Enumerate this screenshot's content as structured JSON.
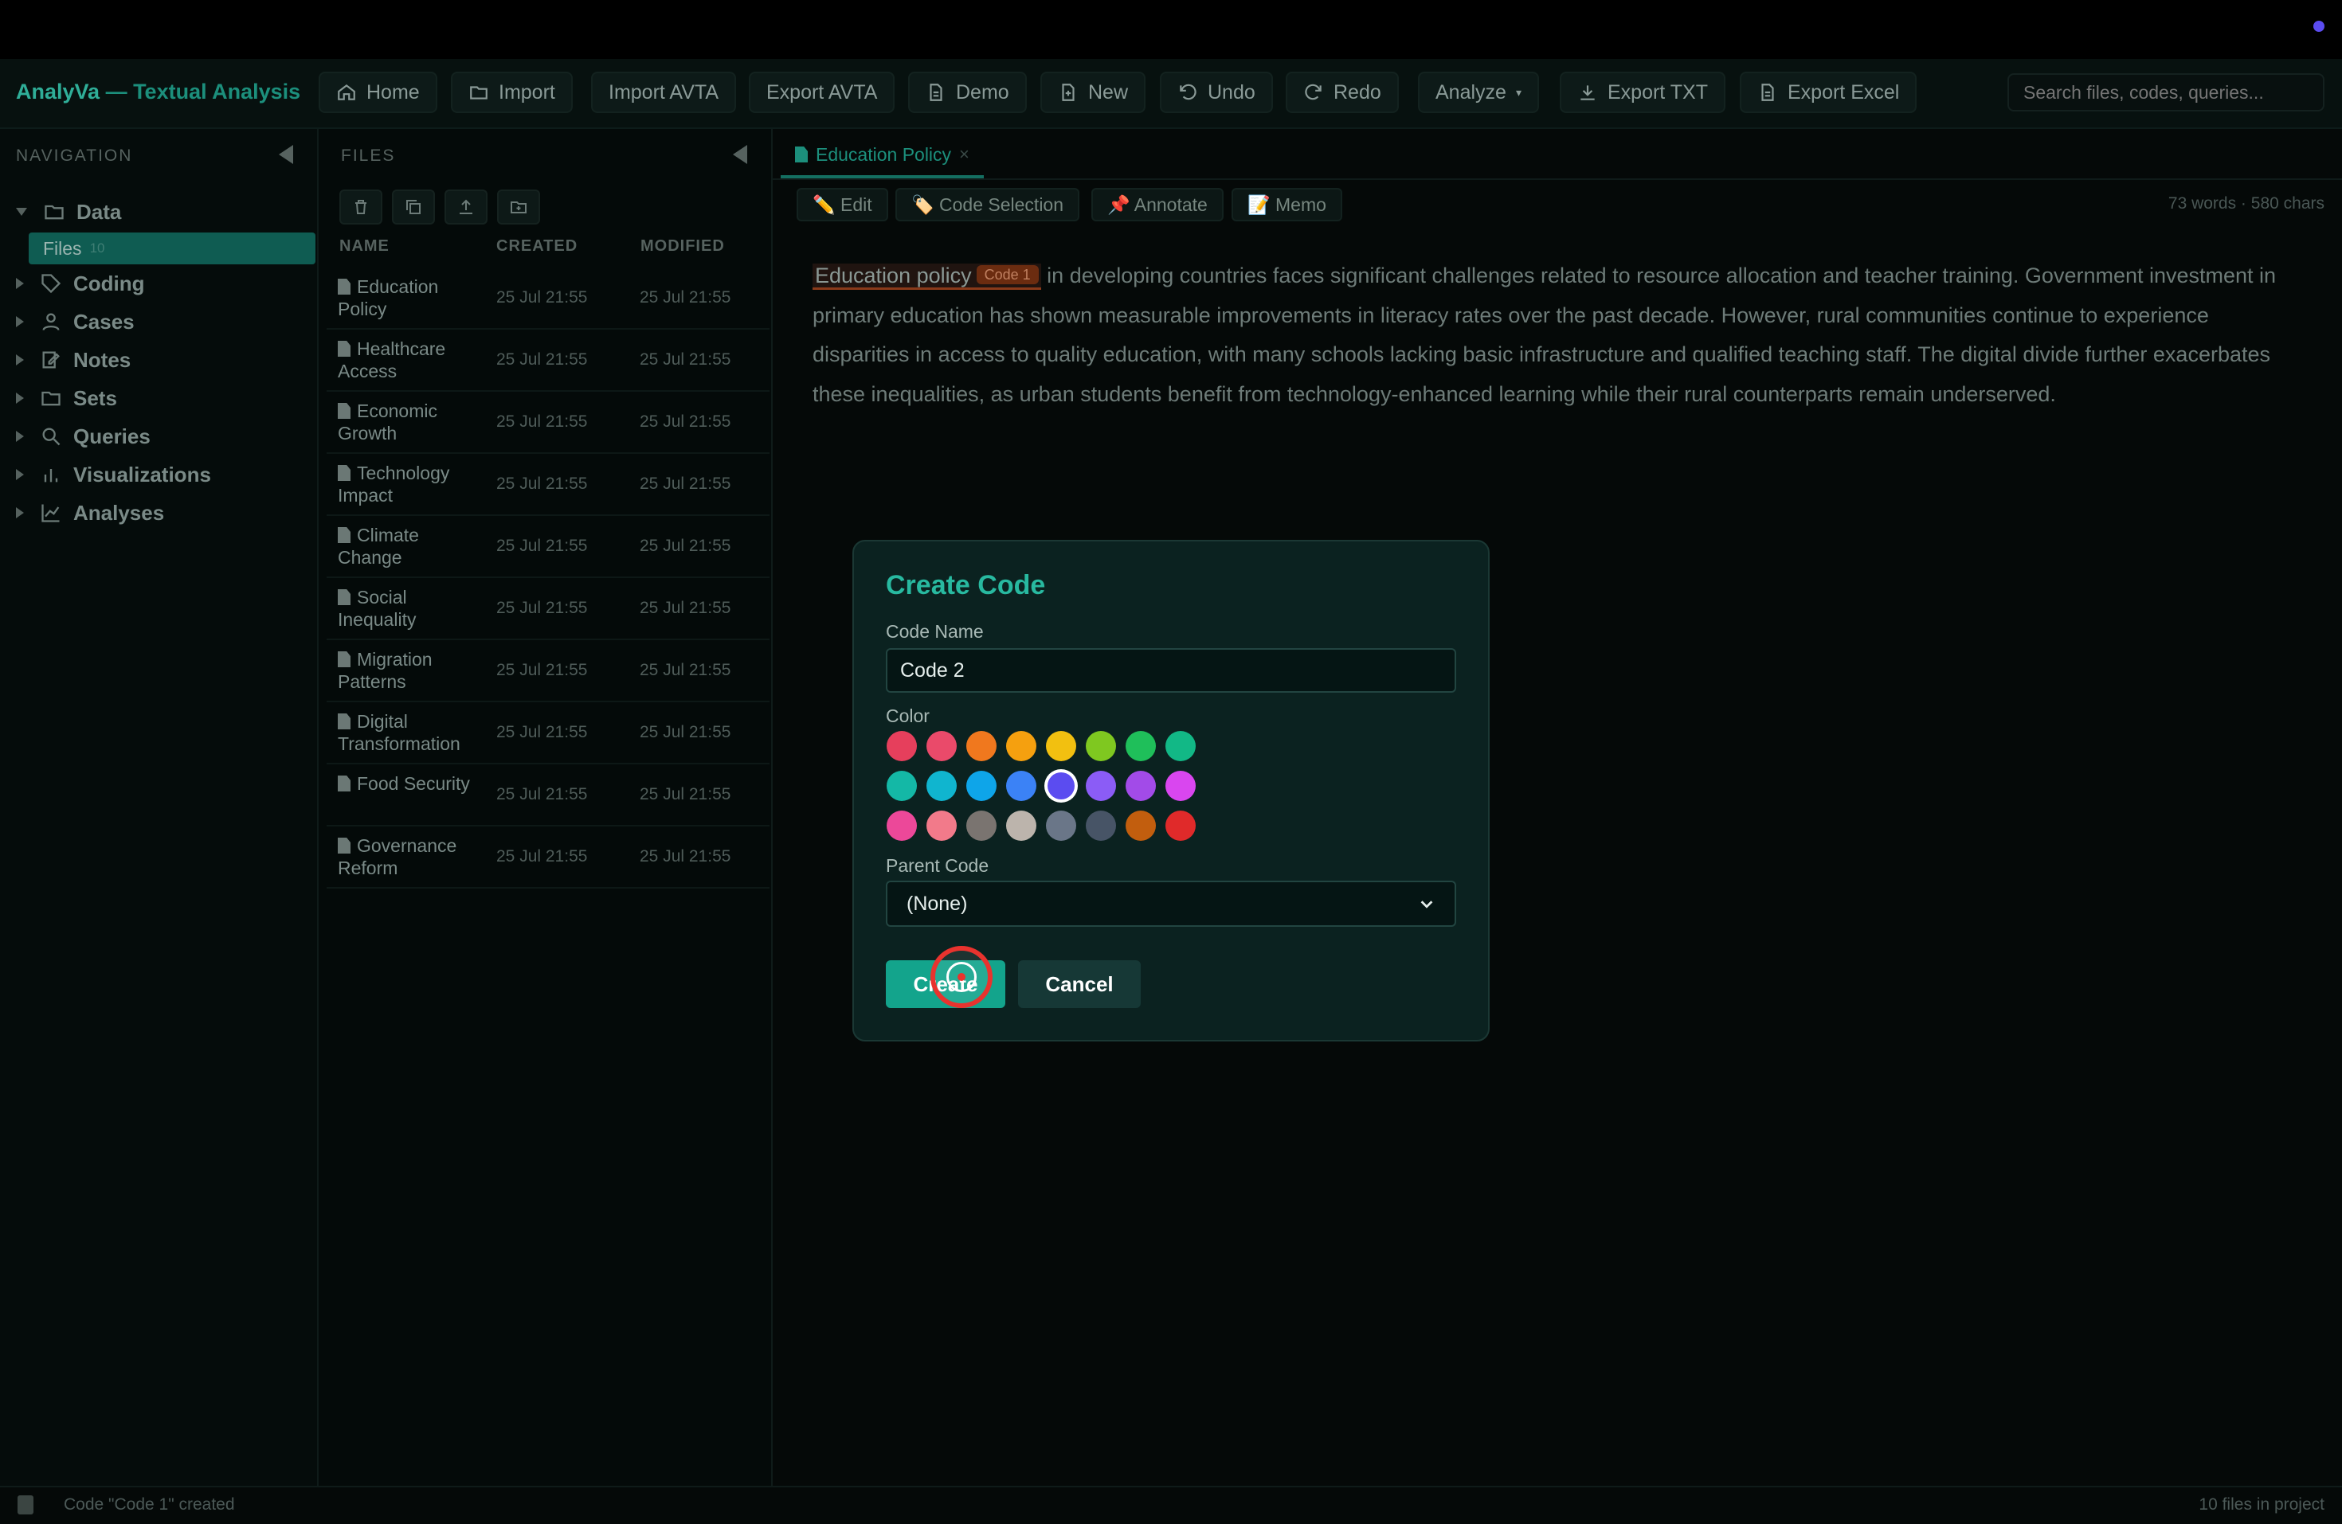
{
  "app": {
    "brand_a": "AnalyVa",
    "brand_b": " — Textual Analysis"
  },
  "toolbar": {
    "home": "Home",
    "import": "Import",
    "import_avta": "Import AVTA",
    "export_avta": "Export AVTA",
    "demo": "Demo",
    "new": "New",
    "undo": "Undo",
    "redo": "Redo",
    "analyze": "Analyze",
    "export_txt": "Export TXT",
    "export_excel": "Export Excel",
    "search_placeholder": "Search files, codes, queries..."
  },
  "navigation": {
    "header": "NAVIGATION",
    "items": [
      "Data",
      "Coding",
      "Cases",
      "Notes",
      "Sets",
      "Queries",
      "Visualizations",
      "Analyses"
    ],
    "files_item": "Files",
    "files_count": "10"
  },
  "files": {
    "header": "FILES",
    "columns": [
      "NAME",
      "CREATED",
      "MODIFIED"
    ],
    "rows": [
      {
        "name": "Education Policy",
        "created": "25 Jul 21:55",
        "modified": "25 Jul 21:55"
      },
      {
        "name": "Healthcare Access",
        "created": "25 Jul 21:55",
        "modified": "25 Jul 21:55"
      },
      {
        "name": "Economic Growth",
        "created": "25 Jul 21:55",
        "modified": "25 Jul 21:55"
      },
      {
        "name": "Technology Impact",
        "created": "25 Jul 21:55",
        "modified": "25 Jul 21:55"
      },
      {
        "name": "Climate Change",
        "created": "25 Jul 21:55",
        "modified": "25 Jul 21:55"
      },
      {
        "name": "Social Inequality",
        "created": "25 Jul 21:55",
        "modified": "25 Jul 21:55"
      },
      {
        "name": "Migration Patterns",
        "created": "25 Jul 21:55",
        "modified": "25 Jul 21:55"
      },
      {
        "name": "Digital Transformation",
        "created": "25 Jul 21:55",
        "modified": "25 Jul 21:55"
      },
      {
        "name": "Food Security",
        "created": "25 Jul 21:55",
        "modified": "25 Jul 21:55"
      },
      {
        "name": "Governance Reform",
        "created": "25 Jul 21:55",
        "modified": "25 Jul 21:55"
      }
    ]
  },
  "editor": {
    "tab": "Education Policy",
    "tab_close": "×",
    "buttons": {
      "edit": "✏️ Edit",
      "code_selection": "🏷️ Code Selection",
      "annotate": "📌 Annotate",
      "memo": "📝 Memo"
    },
    "stats": "73 words · 580 chars",
    "coded_text": "Education policy",
    "code_tag": "Code 1",
    "body": " in developing countries faces significant challenges related to resource allocation and teacher training. Government investment in primary education has shown measurable improvements in literacy rates over the past decade. However, rural communities continue to experience disparities in access to quality education, with many schools lacking basic infrastructure and qualified teaching staff. The digital divide further exacerbates these inequalities, as urban students benefit from technology-enhanced learning while their rural counterparts remain underserved."
  },
  "modal": {
    "title": "Create Code",
    "name_label": "Code Name",
    "name_value": "Code 2",
    "color_label": "Color",
    "colors": [
      "#e63f5c",
      "#ea4a6a",
      "#f0781e",
      "#f5a00f",
      "#f2c010",
      "#7fc820",
      "#1fbf5a",
      "#12b886",
      "#14b8a6",
      "#10b5cf",
      "#0ea5e9",
      "#3b82f6",
      "#5b4cf0",
      "#8b5cf6",
      "#a24be8",
      "#d946ef",
      "#ec4899",
      "#f27a8a",
      "#7a7470",
      "#bcb4ac",
      "#6a7688",
      "#475466",
      "#c25e0e",
      "#e02a2a"
    ],
    "selected_color": "#5b4cf0",
    "parent_label": "Parent Code",
    "parent_value": "(None)",
    "create": "Create",
    "cancel": "Cancel"
  },
  "status": {
    "left": "Code \"Code 1\" created",
    "right": "10 files in project"
  }
}
